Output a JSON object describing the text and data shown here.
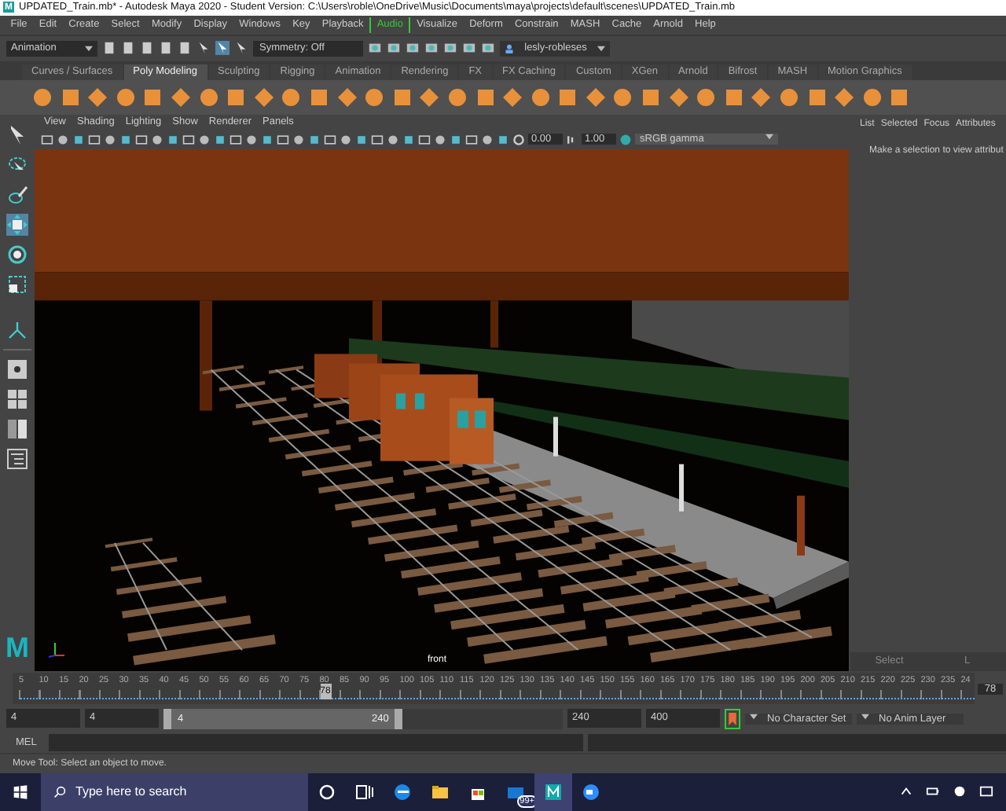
{
  "logo": "M",
  "window": {
    "logo": "M",
    "title": "UPDATED_Train.mb* - Autodesk Maya 2020 - Student Version: C:\\Users\\roble\\OneDrive\\Music\\Documents\\maya\\projects\\default\\scenes\\UPDATED_Train.mb"
  },
  "menu": [
    {
      "label": "File",
      "selected": false
    },
    {
      "label": "Edit",
      "selected": false
    },
    {
      "label": "Create",
      "selected": false
    },
    {
      "label": "Select",
      "selected": false
    },
    {
      "label": "Modify",
      "selected": false
    },
    {
      "label": "Display",
      "selected": false
    },
    {
      "label": "Windows",
      "selected": false
    },
    {
      "label": "Key",
      "selected": false
    },
    {
      "label": "Playback",
      "selected": false
    },
    {
      "label": "Audio",
      "selected": true
    },
    {
      "label": "Visualize",
      "selected": false
    },
    {
      "label": "Deform",
      "selected": false
    },
    {
      "label": "Constrain",
      "selected": false
    },
    {
      "label": "MASH",
      "selected": false
    },
    {
      "label": "Cache",
      "selected": false
    },
    {
      "label": "Arnold",
      "selected": false
    },
    {
      "label": "Help",
      "selected": false
    }
  ],
  "status_line": {
    "menu_set": "Animation",
    "symmetry": "Symmetry: Off",
    "account": "lesly-robleses"
  },
  "shelf_tabs": [
    {
      "label": "Curves / Surfaces",
      "selected": false
    },
    {
      "label": "Poly Modeling",
      "selected": true
    },
    {
      "label": "Sculpting",
      "selected": false
    },
    {
      "label": "Rigging",
      "selected": false
    },
    {
      "label": "Animation",
      "selected": false
    },
    {
      "label": "Rendering",
      "selected": false
    },
    {
      "label": "FX",
      "selected": false
    },
    {
      "label": "FX Caching",
      "selected": false
    },
    {
      "label": "Custom",
      "selected": false
    },
    {
      "label": "XGen",
      "selected": false
    },
    {
      "label": "Arnold",
      "selected": false
    },
    {
      "label": "Bifrost",
      "selected": false
    },
    {
      "label": "MASH",
      "selected": false
    },
    {
      "label": "Motion Graphics",
      "selected": false
    }
  ],
  "tools": [
    {
      "kind": "select",
      "selected": false
    },
    {
      "kind": "lasso",
      "selected": false
    },
    {
      "kind": "paint",
      "selected": false
    },
    {
      "kind": "move",
      "selected": true
    },
    {
      "kind": "rotate",
      "selected": false
    },
    {
      "kind": "scale",
      "selected": false
    }
  ],
  "panel_menu": [
    "View",
    "Shading",
    "Lighting",
    "Show",
    "Renderer",
    "Panels"
  ],
  "panel_toolbar": {
    "exposure": "0.00",
    "gamma": "1.00",
    "color_space": "sRGB gamma"
  },
  "viewport": {
    "camera_label": "front"
  },
  "channel_box": {
    "tabs": [
      "List",
      "Selected",
      "Focus",
      "Attributes"
    ],
    "message": "Make a selection to view attribut",
    "bottom_tabs": [
      "Select",
      "L"
    ]
  },
  "time_slider": {
    "tick_labels": [
      "5",
      "10",
      "15",
      "20",
      "25",
      "30",
      "35",
      "40",
      "45",
      "50",
      "55",
      "60",
      "65",
      "70",
      "75",
      "80",
      "85",
      "90",
      "95",
      "100",
      "105",
      "110",
      "115",
      "120",
      "125",
      "130",
      "135",
      "140",
      "145",
      "150",
      "155",
      "160",
      "165",
      "170",
      "175",
      "180",
      "185",
      "190",
      "195",
      "200",
      "205",
      "210",
      "215",
      "220",
      "225",
      "230",
      "235",
      "24"
    ],
    "current_frame": "78",
    "level": 0.315,
    "frame_field": "78"
  },
  "range_slider": {
    "start": "4",
    "playback_start": "4",
    "bar_start": "4",
    "bar_end": "240",
    "level": 0.6,
    "playback_end": "240",
    "end": "400",
    "character_set": "No Character Set",
    "anim_layer": "No Anim Layer"
  },
  "command_line": {
    "language": "MEL"
  },
  "help_line": "Move Tool: Select an object to move.",
  "taskbar": {
    "search_placeholder": "Type here to search",
    "apps": [
      {
        "kind": "cortana",
        "active": false
      },
      {
        "kind": "taskview",
        "active": false
      },
      {
        "kind": "edge",
        "active": false
      },
      {
        "kind": "explorer",
        "active": false
      },
      {
        "kind": "store",
        "active": false
      },
      {
        "kind": "mail",
        "active": false,
        "badge": "99+"
      },
      {
        "kind": "maya",
        "active": true
      },
      {
        "kind": "zoom",
        "active": false
      }
    ]
  }
}
